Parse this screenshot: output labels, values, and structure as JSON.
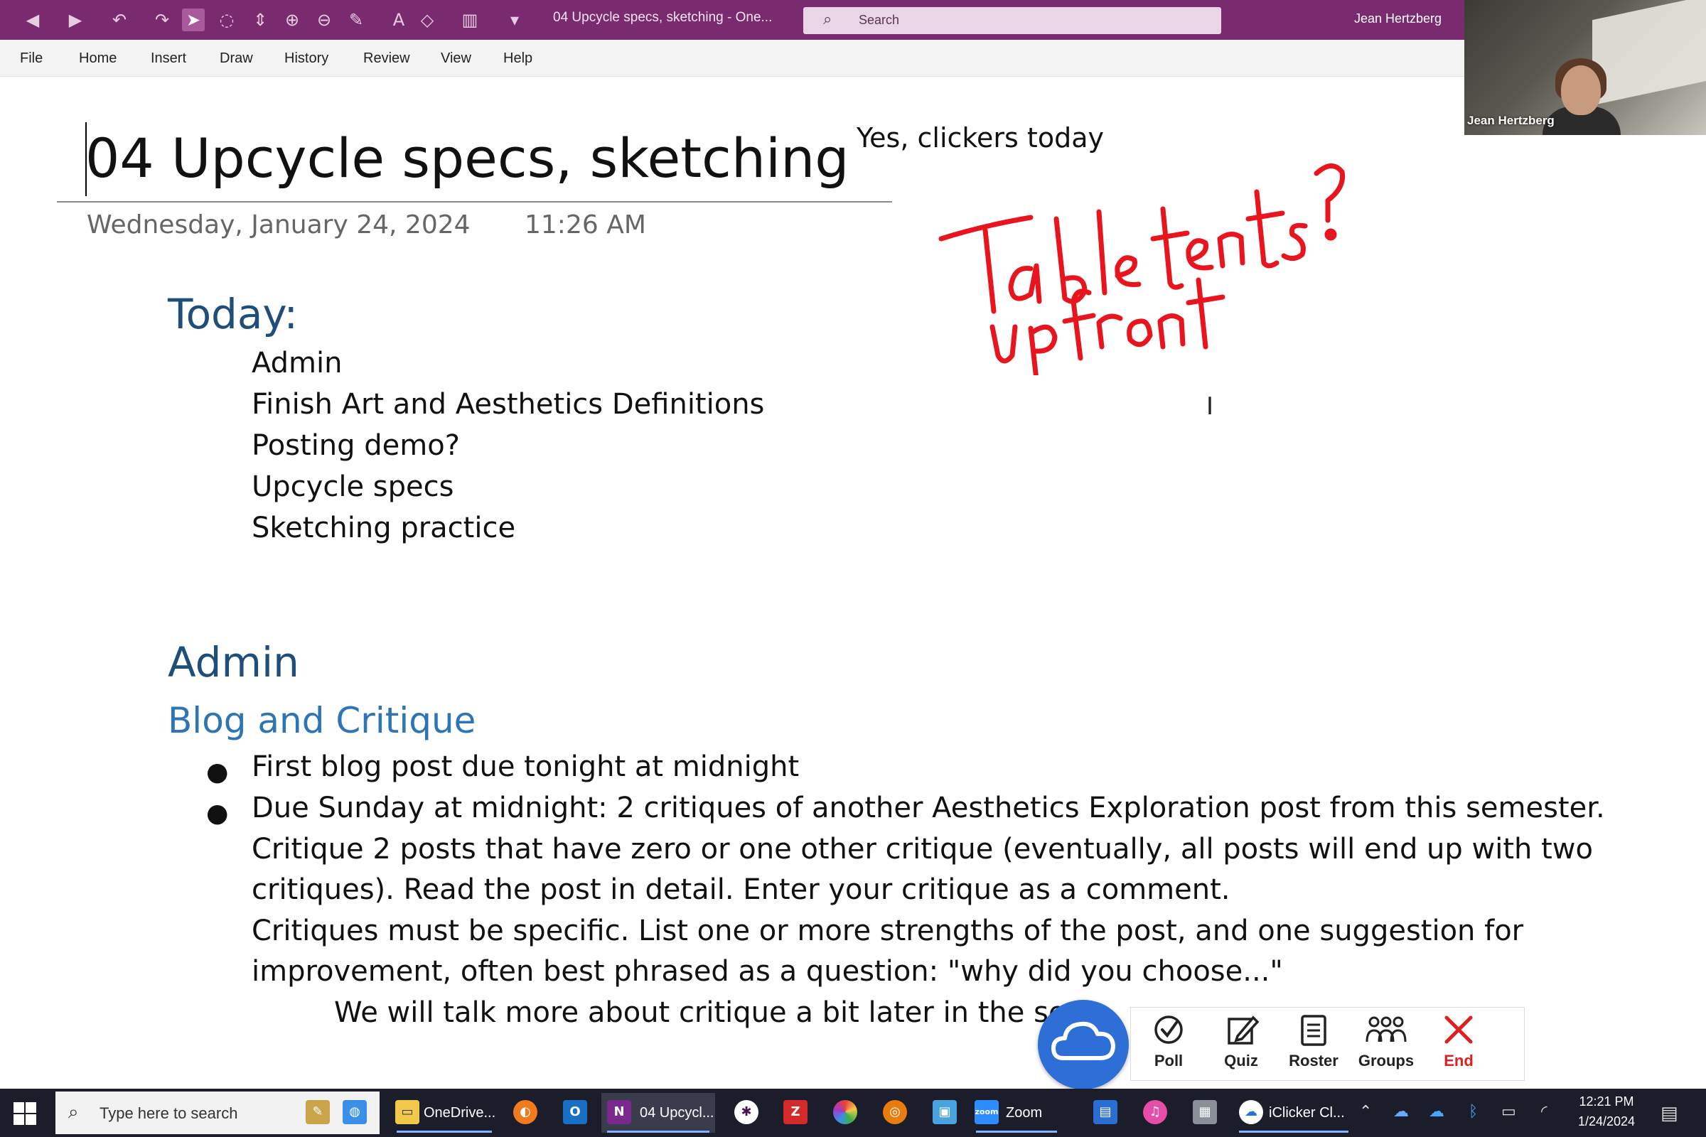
{
  "titlebar": {
    "doc_title": "04 Upcycle specs, sketching  -  One...",
    "search_placeholder": "Search",
    "user_name": "Jean Hertzberg",
    "color": "#7a2a6e"
  },
  "menu": [
    "File",
    "Home",
    "Insert",
    "Draw",
    "History",
    "Review",
    "View",
    "Help"
  ],
  "page": {
    "title": "04 Upcycle specs, sketching",
    "date": "Wednesday, January 24, 2024",
    "time": "11:26 AM",
    "note_clickers": "Yes, clickers today",
    "ink_note": [
      "Table tents?",
      "Up front"
    ],
    "ink_color": "#e8141e",
    "today_heading": "Today:",
    "agenda": [
      "Admin",
      "Finish Art and Aesthetics Definitions",
      "Posting demo?",
      "Upcycle specs",
      "Sketching practice"
    ],
    "admin_heading": "Admin",
    "blog_heading": "Blog and Critique",
    "bullet1": "First blog post due tonight at midnight",
    "bullet2_lines": [
      "Due Sunday at midnight: 2 critiques of another Aesthetics Exploration post from this semester.",
      "Critique 2 posts that have zero or one other critique (eventually, all posts will end up with two",
      "critiques). Read the post in detail. Enter your critique as a comment.",
      "Critiques must be specific. List one or more strengths of the post, and one suggestion for",
      "improvement, often best phrased as a question: \"why did you choose...\""
    ],
    "indent_line": "We will talk more about critique a bit later in the sem"
  },
  "webcam": {
    "name": "Jean Hertzberg"
  },
  "iclicker": {
    "buttons": [
      "Poll",
      "Quiz",
      "Roster",
      "Groups",
      "End"
    ],
    "end_color": "#e02020",
    "cloud_color": "#2d6fd6"
  },
  "taskbar": {
    "search_placeholder": "Type here to search",
    "apps": [
      "OneDrive...",
      "04 Upcycl...",
      "Zoom",
      "iClicker Cl..."
    ],
    "clock_time": "12:21 PM",
    "clock_date": "1/24/2024"
  }
}
